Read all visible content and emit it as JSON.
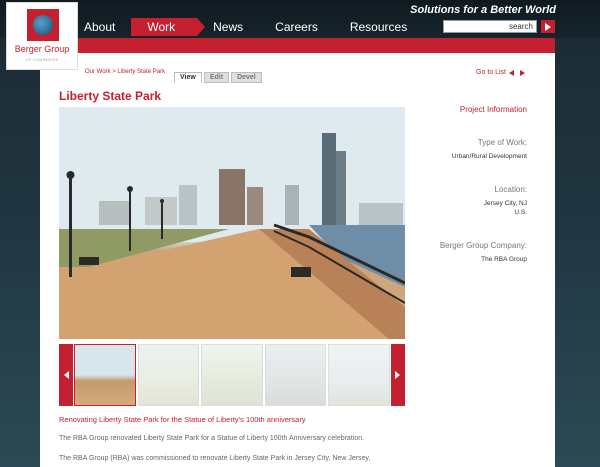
{
  "header": {
    "tagline": "Solutions for a Better World",
    "search_label": "search",
    "nav": [
      {
        "label": "About",
        "active": false
      },
      {
        "label": "Work",
        "active": true
      },
      {
        "label": "News",
        "active": false
      },
      {
        "label": "Careers",
        "active": false
      },
      {
        "label": "Resources",
        "active": false
      }
    ]
  },
  "logo": {
    "name": "Berger Group",
    "subtitle": "OF COMPANIES"
  },
  "breadcrumb": {
    "root": "Our Work",
    "separator": ">",
    "current": "Liberty State Park"
  },
  "tabs": [
    {
      "label": "View",
      "active": true
    },
    {
      "label": "Edit",
      "active": false
    },
    {
      "label": "Devel",
      "active": false
    }
  ],
  "goto": {
    "label": "Go to List"
  },
  "page": {
    "title": "Liberty State Park",
    "caption": "Renovating Liberty State Park for the Statue of Liberty's 100th anniversary",
    "paragraph1": "The RBA Group renovated Liberty State Park for a Statue of Liberty 100th Anniversary celebration.",
    "paragraph2": "The RBA Group (RBA) was commissioned to renovate Liberty State Park in Jersey City, New Jersey,"
  },
  "info": {
    "heading": "Project Information",
    "type_label": "Type of Work:",
    "type_value": "Urban/Rural Development",
    "location_label": "Location:",
    "location_line1": "Jersey City, NJ",
    "location_line2": "U.S.",
    "company_label": "Berger Group Company:",
    "company_value": "The RBA Group"
  },
  "colors": {
    "brand_red": "#c4202f",
    "background_dark": "#1b2a33"
  },
  "icons": {
    "prev": "arrow-left-icon",
    "next": "arrow-right-icon",
    "search": "search-go-icon"
  }
}
